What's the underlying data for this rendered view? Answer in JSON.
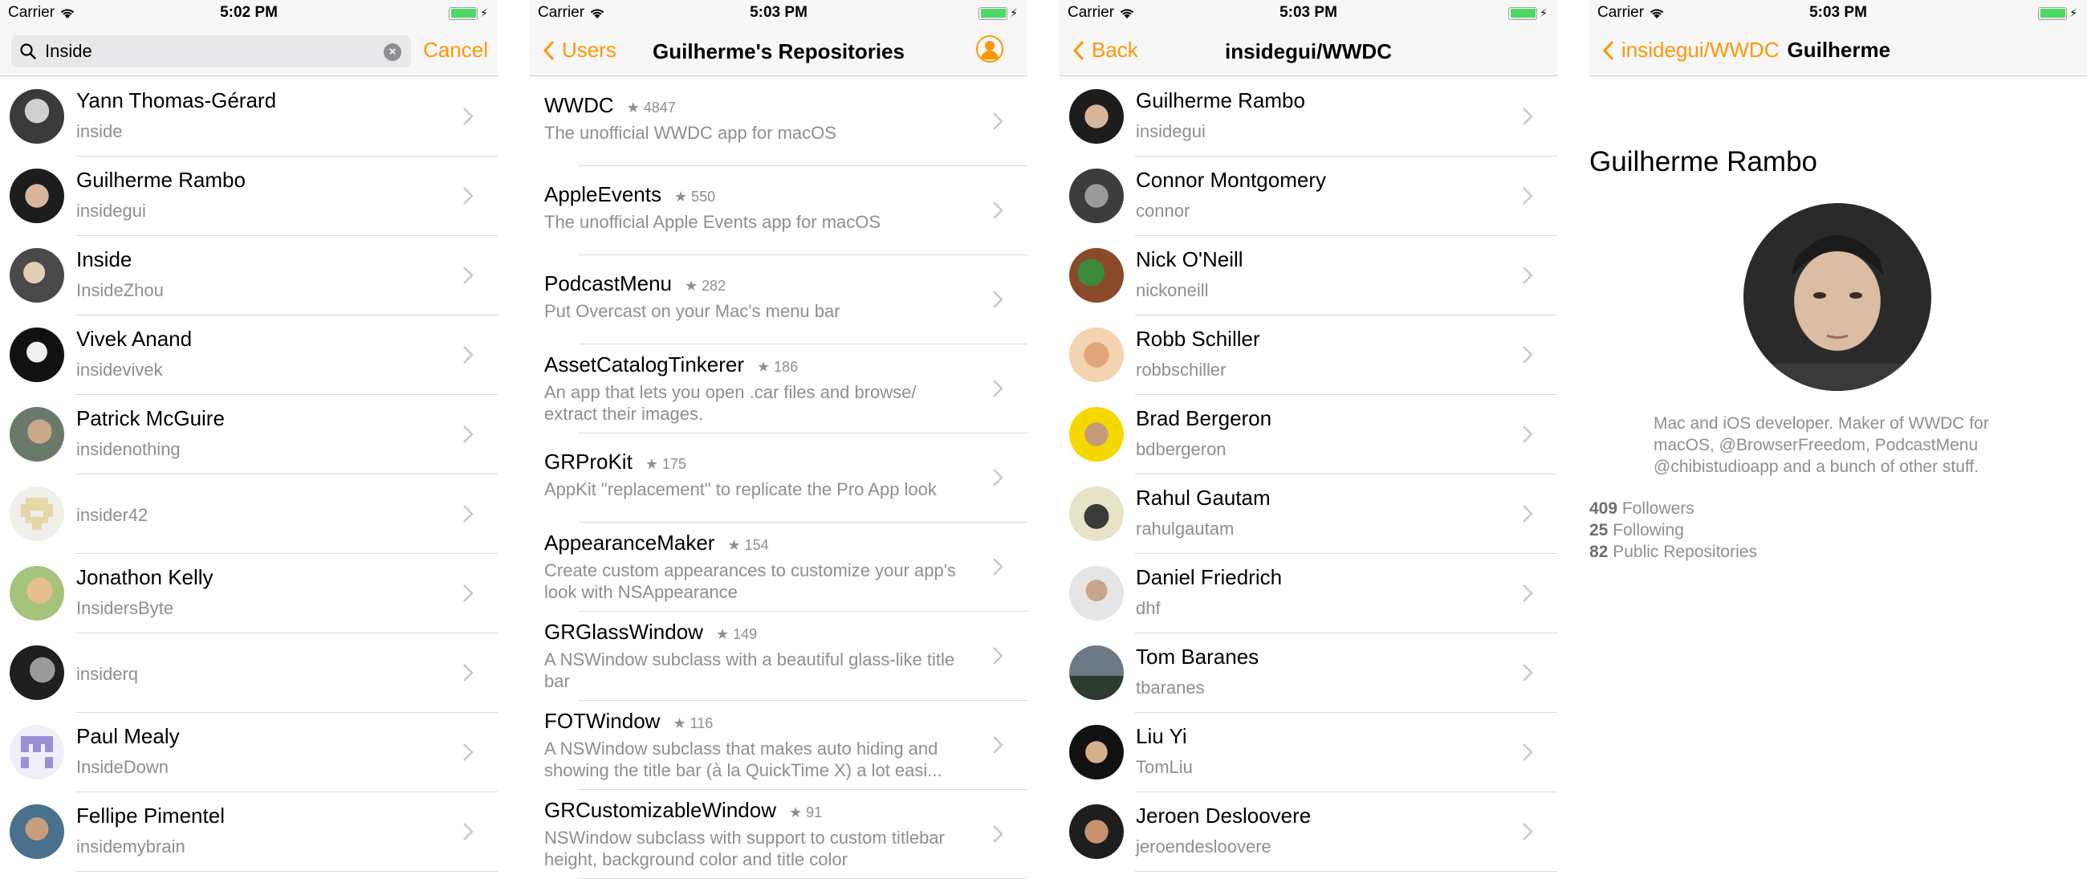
{
  "status_bar": {
    "carrier": "Carrier",
    "times": [
      "5:02 PM",
      "5:03 PM",
      "5:03 PM",
      "5:03 PM"
    ]
  },
  "screen1": {
    "search_value": "Inside",
    "cancel_label": "Cancel",
    "rows": [
      {
        "name": "Yann Thomas-Gérard",
        "login": "inside"
      },
      {
        "name": "Guilherme Rambo",
        "login": "insidegui"
      },
      {
        "name": "Inside",
        "login": "InsideZhou"
      },
      {
        "name": "Vivek Anand",
        "login": "insidevivek"
      },
      {
        "name": "Patrick McGuire",
        "login": "insidenothing"
      },
      {
        "name": "",
        "login": "insider42"
      },
      {
        "name": "Jonathon Kelly",
        "login": "InsidersByte"
      },
      {
        "name": "",
        "login": "insiderq"
      },
      {
        "name": "Paul Mealy",
        "login": "InsideDown"
      },
      {
        "name": "Fellipe Pimentel",
        "login": "insidemybrain"
      }
    ]
  },
  "screen2": {
    "back_label": "Users",
    "title": "Guilherme's Repositories",
    "repos": [
      {
        "name": "WWDC",
        "stars": "★ 4847",
        "desc": "The unofficial WWDC app for macOS"
      },
      {
        "name": "AppleEvents",
        "stars": "★ 550",
        "desc": "The unofficial Apple Events app for macOS"
      },
      {
        "name": "PodcastMenu",
        "stars": "★ 282",
        "desc": "Put Overcast on your Mac's menu bar"
      },
      {
        "name": "AssetCatalogTinkerer",
        "stars": "★ 186",
        "desc": "An app that lets you open .car files and browse/ extract their images."
      },
      {
        "name": "GRProKit",
        "stars": "★ 175",
        "desc": "AppKit \"replacement\" to replicate the Pro App look"
      },
      {
        "name": "AppearanceMaker",
        "stars": "★ 154",
        "desc": "Create custom appearances to customize your app's look with NSAppearance"
      },
      {
        "name": "GRGlassWindow",
        "stars": "★ 149",
        "desc": "A NSWindow subclass with a beautiful glass-like title bar"
      },
      {
        "name": "FOTWindow",
        "stars": "★ 116",
        "desc": "A NSWindow subclass that makes auto hiding and showing the title bar (à la QuickTime X) a lot easi..."
      },
      {
        "name": "GRCustomizableWindow",
        "stars": "★ 91",
        "desc": "NSWindow subclass with support to custom titlebar height, background color and title color"
      }
    ]
  },
  "screen3": {
    "back_label": "Back",
    "title": "insidegui/WWDC",
    "rows": [
      {
        "name": "Guilherme Rambo",
        "login": "insidegui"
      },
      {
        "name": "Connor Montgomery",
        "login": "connor"
      },
      {
        "name": "Nick O'Neill",
        "login": "nickoneill"
      },
      {
        "name": "Robb Schiller",
        "login": "robbschiller"
      },
      {
        "name": "Brad Bergeron",
        "login": "bdbergeron"
      },
      {
        "name": "Rahul Gautam",
        "login": "rahulgautam"
      },
      {
        "name": "Daniel Friedrich",
        "login": "dhf"
      },
      {
        "name": "Tom Baranes",
        "login": "tbaranes"
      },
      {
        "name": "Liu Yi",
        "login": "TomLiu"
      },
      {
        "name": "Jeroen Desloovere",
        "login": "jeroendesloovere"
      }
    ]
  },
  "screen4": {
    "back_label": "insidegui/WWDC",
    "title": "Guilherme",
    "name": "Guilherme Rambo",
    "bio": "Mac and iOS developer. Maker of WWDC for macOS, @BrowserFreedom, PodcastMenu @chibistudioapp and a bunch of other stuff.",
    "followers_count": "409",
    "followers_label": "Followers",
    "following_count": "25",
    "following_label": "Following",
    "repos_count": "82",
    "repos_label": "Public Repositories"
  },
  "colors": {
    "accent": "#ff9500",
    "secondary_text": "#8e8e93",
    "battery": "#4cd964",
    "separator": "#d9d9dc"
  },
  "icons": [
    "search-icon",
    "clear-icon",
    "chevron-left-icon",
    "chevron-right-icon",
    "wifi-icon",
    "battery-icon",
    "user-avatar-icon"
  ]
}
